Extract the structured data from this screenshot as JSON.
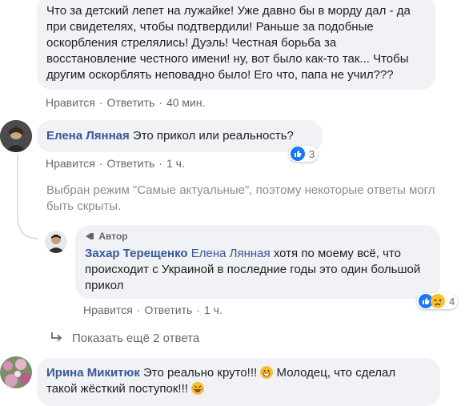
{
  "comments": [
    {
      "text": "Что за детский лепет на лужайке! Уже давно бы в морду дал - да при свидетелях, чтобы подтвердили! Раньше за подобные оскорбления стрелялись! Дуэль! Честная борьба за восстановление честного имени! ну, вот было как-то так... Чтобы другим оскорблять неповадно было! Его что, папа не учил???",
      "like": "Нравится",
      "reply": "Ответить",
      "time": "40 мин."
    },
    {
      "author": "Елена Лянная",
      "text": "Это прикол или реальность?",
      "like": "Нравится",
      "reply": "Ответить",
      "time": "1 ч.",
      "reaction_count": "3"
    }
  ],
  "filter_note": "Выбран режим \"Самые актуальные\", поэтому некоторые ответы могл быть скрыты.",
  "reply": {
    "badge": "Автор",
    "author": "Захар Терещенко",
    "mention": "Елена Лянная",
    "text": "хотя по моему всё, что происходит с Украиной в последние годы это один большой прикол",
    "like": "Нравится",
    "reply": "Ответить",
    "time": "1 ч.",
    "reaction_count": "4"
  },
  "show_more": "Показать ещё 2 ответа",
  "last_comment": {
    "author": "Ирина Микитюк",
    "text1": "Это реально круто!!!",
    "text2": "Молодец, что сделал такой жёсткий поступок!!!"
  },
  "colors": {
    "link": "#385898",
    "bubble": "#f0f2f5",
    "meta": "#65676b",
    "like_blue": "#1877f2"
  }
}
